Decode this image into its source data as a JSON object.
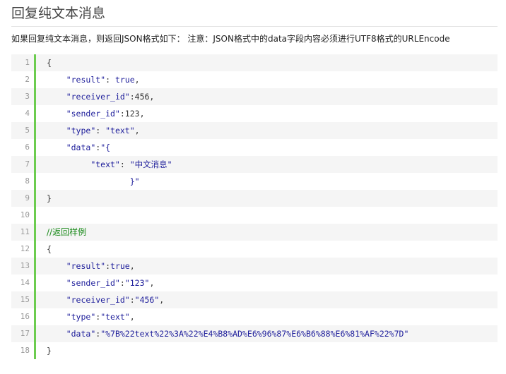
{
  "title": "回复纯文本消息",
  "intro": "如果回复纯文本消息，则返回JSON格式如下：  注意：JSON格式中的data字段内容必须进行UTF8格式的URLEncode",
  "code": {
    "lines": [
      [
        {
          "t": "{",
          "c": "p"
        }
      ],
      [
        {
          "t": "    ",
          "c": "p"
        },
        {
          "t": "\"result\"",
          "c": "str"
        },
        {
          "t": ": ",
          "c": "p"
        },
        {
          "t": "true",
          "c": "kw"
        },
        {
          "t": ",",
          "c": "p"
        }
      ],
      [
        {
          "t": "    ",
          "c": "p"
        },
        {
          "t": "\"receiver_id\"",
          "c": "str"
        },
        {
          "t": ":456,",
          "c": "p"
        }
      ],
      [
        {
          "t": "    ",
          "c": "p"
        },
        {
          "t": "\"sender_id\"",
          "c": "str"
        },
        {
          "t": ":123,",
          "c": "p"
        }
      ],
      [
        {
          "t": "    ",
          "c": "p"
        },
        {
          "t": "\"type\"",
          "c": "str"
        },
        {
          "t": ": ",
          "c": "p"
        },
        {
          "t": "\"text\"",
          "c": "str"
        },
        {
          "t": ",",
          "c": "p"
        }
      ],
      [
        {
          "t": "    ",
          "c": "p"
        },
        {
          "t": "\"data\"",
          "c": "str"
        },
        {
          "t": ":",
          "c": "p"
        },
        {
          "t": "\"{",
          "c": "str"
        }
      ],
      [
        {
          "t": "         ",
          "c": "p"
        },
        {
          "t": "\"text\"",
          "c": "str"
        },
        {
          "t": ": ",
          "c": "p"
        },
        {
          "t": "\"中文消息\"",
          "c": "str"
        }
      ],
      [
        {
          "t": "                 ",
          "c": "p"
        },
        {
          "t": "}\"",
          "c": "str"
        }
      ],
      [
        {
          "t": "}",
          "c": "p"
        }
      ],
      [
        {
          "t": "",
          "c": "p"
        }
      ],
      [
        {
          "t": "//返回样例",
          "c": "cmt"
        }
      ],
      [
        {
          "t": "{",
          "c": "p"
        }
      ],
      [
        {
          "t": "    ",
          "c": "p"
        },
        {
          "t": "\"result\"",
          "c": "str"
        },
        {
          "t": ":",
          "c": "p"
        },
        {
          "t": "true",
          "c": "kw"
        },
        {
          "t": ",",
          "c": "p"
        }
      ],
      [
        {
          "t": "    ",
          "c": "p"
        },
        {
          "t": "\"sender_id\"",
          "c": "str"
        },
        {
          "t": ":",
          "c": "p"
        },
        {
          "t": "\"123\"",
          "c": "str"
        },
        {
          "t": ",",
          "c": "p"
        }
      ],
      [
        {
          "t": "    ",
          "c": "p"
        },
        {
          "t": "\"receiver_id\"",
          "c": "str"
        },
        {
          "t": ":",
          "c": "p"
        },
        {
          "t": "\"456\"",
          "c": "str"
        },
        {
          "t": ",",
          "c": "p"
        }
      ],
      [
        {
          "t": "    ",
          "c": "p"
        },
        {
          "t": "\"type\"",
          "c": "str"
        },
        {
          "t": ":",
          "c": "p"
        },
        {
          "t": "\"text\"",
          "c": "str"
        },
        {
          "t": ",",
          "c": "p"
        }
      ],
      [
        {
          "t": "    ",
          "c": "p"
        },
        {
          "t": "\"data\"",
          "c": "str"
        },
        {
          "t": ":",
          "c": "p"
        },
        {
          "t": "\"%7B%22text%22%3A%22%E4%B8%AD%E6%96%87%E6%B6%88%E6%81%AF%22%7D\"",
          "c": "str"
        }
      ],
      [
        {
          "t": "}",
          "c": "p"
        }
      ]
    ]
  }
}
